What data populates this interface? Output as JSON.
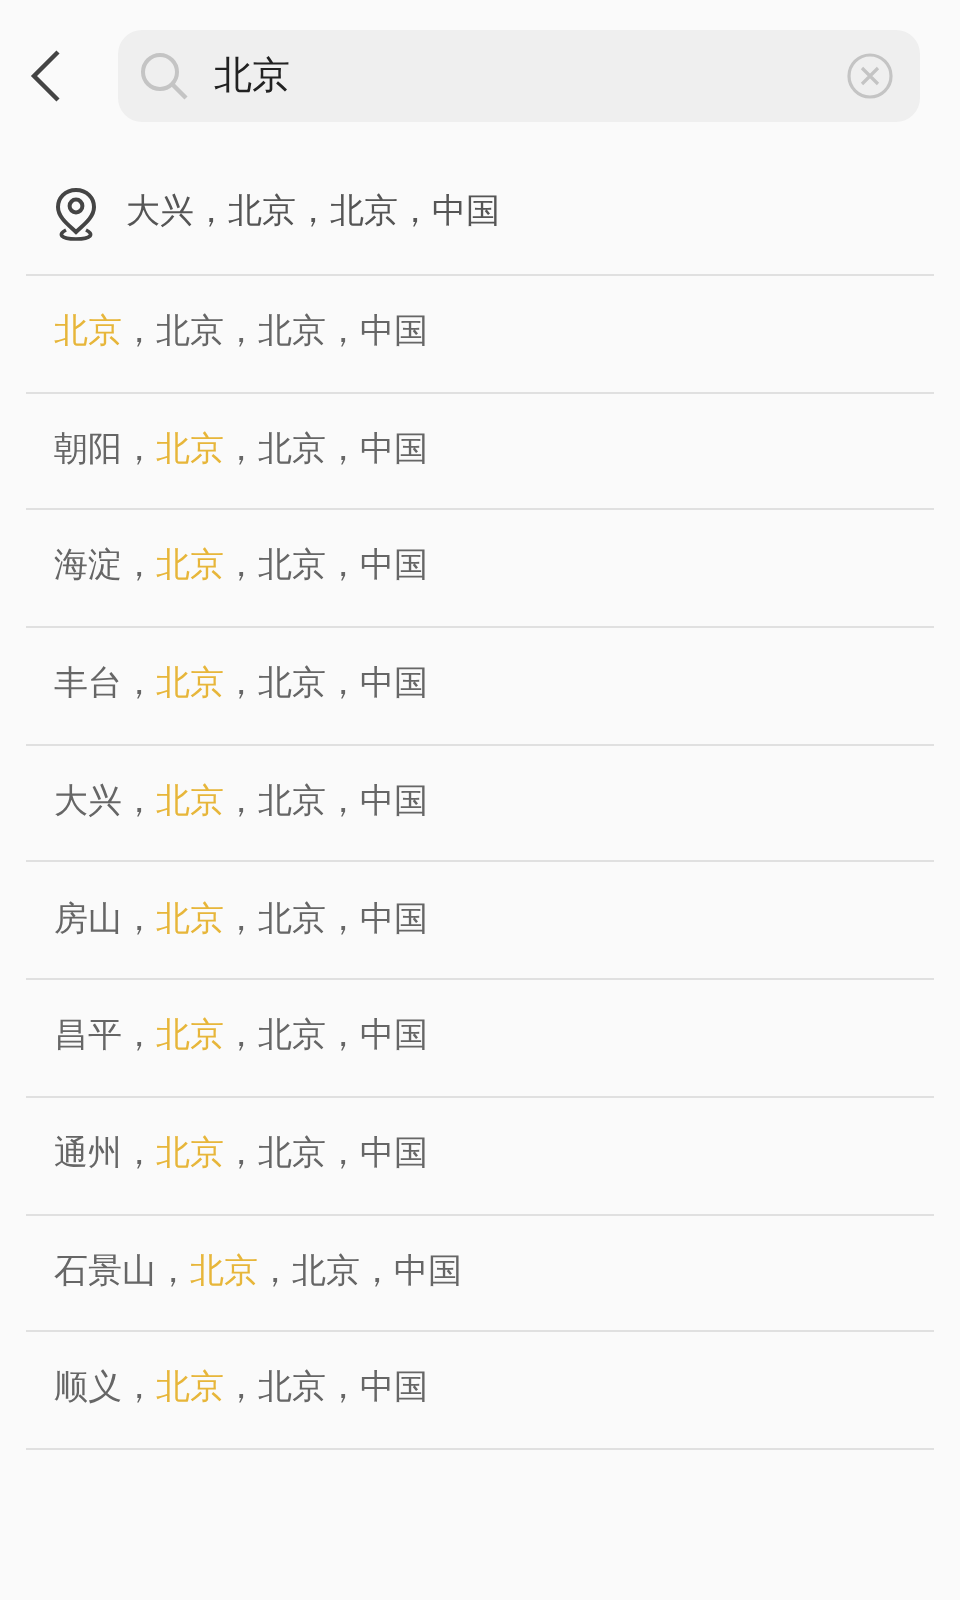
{
  "search": {
    "value": "北京"
  },
  "current_location": {
    "text": "大兴，北京，北京，中国"
  },
  "results": [
    {
      "parts": [
        {
          "text": "北京",
          "highlight": true
        },
        {
          "text": "，北京，北京，中国",
          "highlight": false
        }
      ]
    },
    {
      "parts": [
        {
          "text": "朝阳，",
          "highlight": false
        },
        {
          "text": "北京",
          "highlight": true
        },
        {
          "text": "，北京，中国",
          "highlight": false
        }
      ]
    },
    {
      "parts": [
        {
          "text": "海淀，",
          "highlight": false
        },
        {
          "text": "北京",
          "highlight": true
        },
        {
          "text": "，北京，中国",
          "highlight": false
        }
      ]
    },
    {
      "parts": [
        {
          "text": "丰台，",
          "highlight": false
        },
        {
          "text": "北京",
          "highlight": true
        },
        {
          "text": "，北京，中国",
          "highlight": false
        }
      ]
    },
    {
      "parts": [
        {
          "text": "大兴，",
          "highlight": false
        },
        {
          "text": "北京",
          "highlight": true
        },
        {
          "text": "，北京，中国",
          "highlight": false
        }
      ]
    },
    {
      "parts": [
        {
          "text": "房山，",
          "highlight": false
        },
        {
          "text": "北京",
          "highlight": true
        },
        {
          "text": "，北京，中国",
          "highlight": false
        }
      ]
    },
    {
      "parts": [
        {
          "text": "昌平，",
          "highlight": false
        },
        {
          "text": "北京",
          "highlight": true
        },
        {
          "text": "，北京，中国",
          "highlight": false
        }
      ]
    },
    {
      "parts": [
        {
          "text": "通州，",
          "highlight": false
        },
        {
          "text": "北京",
          "highlight": true
        },
        {
          "text": "，北京，中国",
          "highlight": false
        }
      ]
    },
    {
      "parts": [
        {
          "text": "石景山，",
          "highlight": false
        },
        {
          "text": "北京",
          "highlight": true
        },
        {
          "text": "，北京，中国",
          "highlight": false
        }
      ]
    },
    {
      "parts": [
        {
          "text": "顺义，",
          "highlight": false
        },
        {
          "text": "北京",
          "highlight": true
        },
        {
          "text": "，北京，中国",
          "highlight": false
        }
      ]
    }
  ]
}
